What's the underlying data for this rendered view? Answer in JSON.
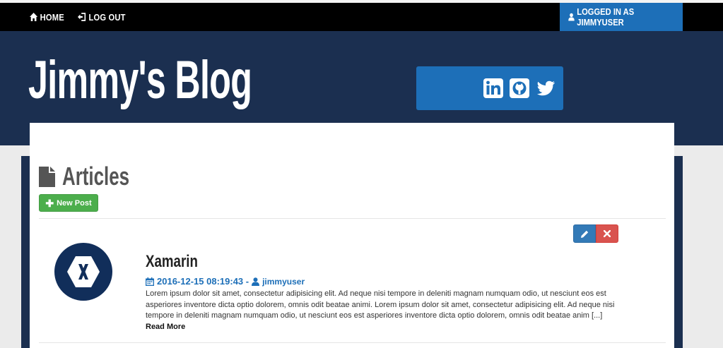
{
  "nav": {
    "home_label": "Home",
    "logout_label": "Log Out",
    "logged_in_label": "Logged in as jimmyuser"
  },
  "header": {
    "blog_title": "Jimmy's Blog",
    "social_icons": [
      "linkedin-icon",
      "github-icon",
      "twitter-icon"
    ]
  },
  "articles": {
    "heading": "Articles",
    "new_post_label": "New Post"
  },
  "post": {
    "title": "Xamarin",
    "date": "2016-12-15 08:19:43 -",
    "author": "jimmyuser",
    "body": "Lorem ipsum dolor sit amet, consectetur adipisicing elit. Ad neque nisi tempore in deleniti magnam numquam odio, ut nesciunt eos est asperiores inventore dicta optio dolorem, omnis odit beatae animi. Lorem ipsum dolor sit amet, consectetur adipisicing elit. Ad neque nisi tempore in deleniti magnam numquam odio, ut nesciunt eos est asperiores inventore dicta optio dolorem, omnis odit beatae anim [...]",
    "read_more": "Read More"
  },
  "colors": {
    "navbar": "#000000",
    "header": "#1b2f50",
    "accent": "#1d6fb8",
    "success": "#4cae4c",
    "danger": "#d9534f"
  }
}
